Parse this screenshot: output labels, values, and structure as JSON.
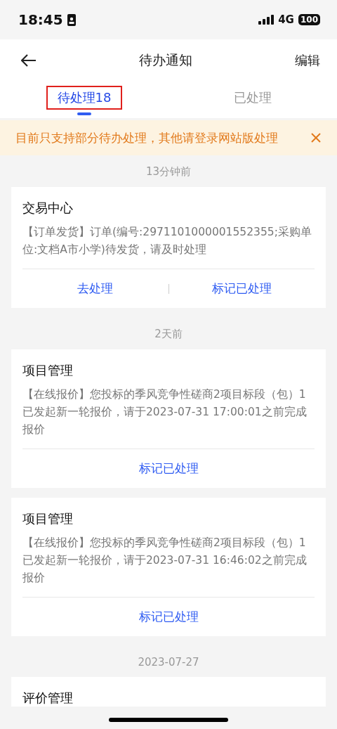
{
  "status_bar": {
    "time": "18:45",
    "network": "4G",
    "battery": "100"
  },
  "nav": {
    "title": "待办通知",
    "action": "编辑"
  },
  "tabs": [
    {
      "label": "待处理18",
      "selected": true,
      "highlighted": true
    },
    {
      "label": "已处理",
      "selected": false,
      "highlighted": false
    }
  ],
  "notice": {
    "text": "目前只支持部分待办处理，其他请登录网站版处理"
  },
  "groups": [
    {
      "time": "13分钟前",
      "cards": [
        {
          "title": "交易中心",
          "body": "【订单发货】订单(编号:2971101000001552355;采购单位:文档A市小学)待发货，请及时处理",
          "actions": [
            "去处理",
            "标记已处理"
          ]
        }
      ]
    },
    {
      "time": "2天前",
      "cards": [
        {
          "title": "项目管理",
          "body": "【在线报价】您投标的季风竞争性磋商2项目标段（包）1已发起新一轮报价，请于2023-07-31 17:00:01之前完成报价",
          "actions": [
            "标记已处理"
          ]
        },
        {
          "title": "项目管理",
          "body": "【在线报价】您投标的季风竞争性磋商2项目标段（包）1已发起新一轮报价，请于2023-07-31 16:46:02之前完成报价",
          "actions": [
            "标记已处理"
          ]
        }
      ]
    },
    {
      "time": "2023-07-27",
      "cards": [
        {
          "title": "评价管理"
        }
      ]
    }
  ]
}
